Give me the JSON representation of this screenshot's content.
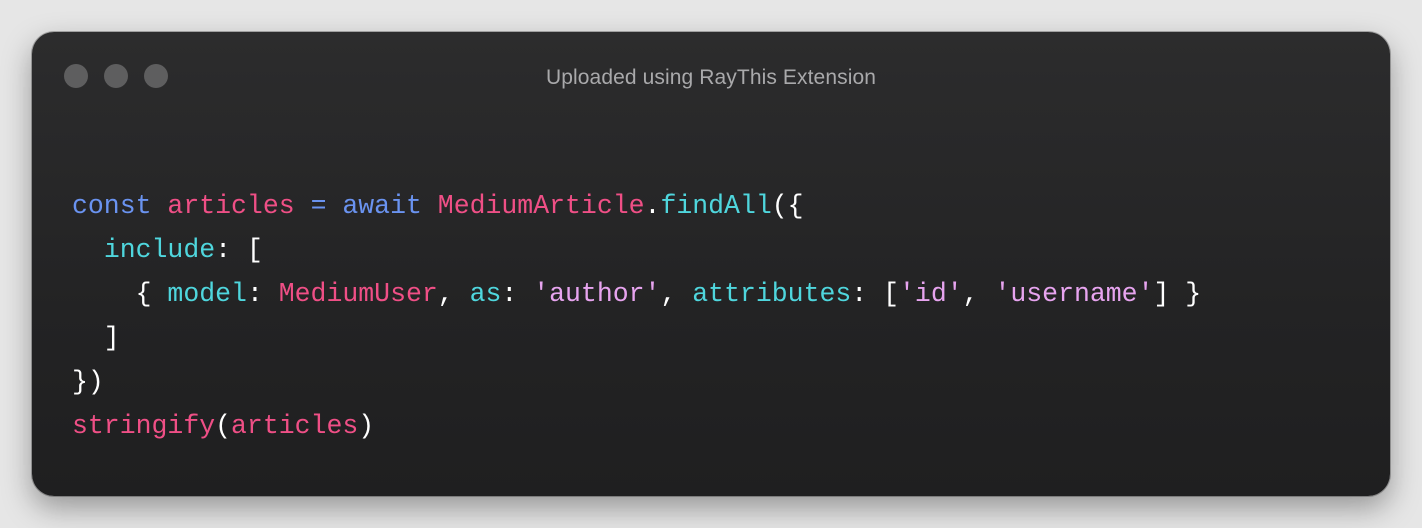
{
  "window": {
    "title": "Uploaded using RayThis Extension",
    "controls": [
      "close",
      "minimize",
      "zoom"
    ]
  },
  "colors": {
    "keyword": "#6a93f0",
    "variable": "#ef4f86",
    "function": "#4fd6dd",
    "string": "#e7a4ef",
    "punctuation": "#ffffff"
  },
  "code": {
    "lines": [
      {
        "tokens": [
          {
            "t": "kw",
            "v": "const"
          },
          {
            "t": "pun",
            "v": " "
          },
          {
            "t": "var",
            "v": "articles"
          },
          {
            "t": "pun",
            "v": " "
          },
          {
            "t": "kw",
            "v": "="
          },
          {
            "t": "pun",
            "v": " "
          },
          {
            "t": "kw",
            "v": "await"
          },
          {
            "t": "pun",
            "v": " "
          },
          {
            "t": "var",
            "v": "MediumArticle"
          },
          {
            "t": "pun",
            "v": "."
          },
          {
            "t": "fn",
            "v": "findAll"
          },
          {
            "t": "pun",
            "v": "({"
          }
        ]
      },
      {
        "tokens": [
          {
            "t": "pun",
            "v": "  "
          },
          {
            "t": "fn",
            "v": "include"
          },
          {
            "t": "pun",
            "v": ": ["
          }
        ]
      },
      {
        "tokens": [
          {
            "t": "pun",
            "v": "    { "
          },
          {
            "t": "fn",
            "v": "model"
          },
          {
            "t": "pun",
            "v": ": "
          },
          {
            "t": "var",
            "v": "MediumUser"
          },
          {
            "t": "pun",
            "v": ", "
          },
          {
            "t": "fn",
            "v": "as"
          },
          {
            "t": "pun",
            "v": ": "
          },
          {
            "t": "str",
            "v": "'author'"
          },
          {
            "t": "pun",
            "v": ", "
          },
          {
            "t": "fn",
            "v": "attributes"
          },
          {
            "t": "pun",
            "v": ": ["
          },
          {
            "t": "str",
            "v": "'id'"
          },
          {
            "t": "pun",
            "v": ", "
          },
          {
            "t": "str",
            "v": "'username'"
          },
          {
            "t": "pun",
            "v": "] }"
          }
        ]
      },
      {
        "tokens": [
          {
            "t": "pun",
            "v": "  ]"
          }
        ]
      },
      {
        "tokens": [
          {
            "t": "pun",
            "v": "})"
          }
        ]
      },
      {
        "tokens": [
          {
            "t": "var",
            "v": "stringify"
          },
          {
            "t": "pun",
            "v": "("
          },
          {
            "t": "var",
            "v": "articles"
          },
          {
            "t": "pun",
            "v": ")"
          }
        ]
      }
    ]
  }
}
